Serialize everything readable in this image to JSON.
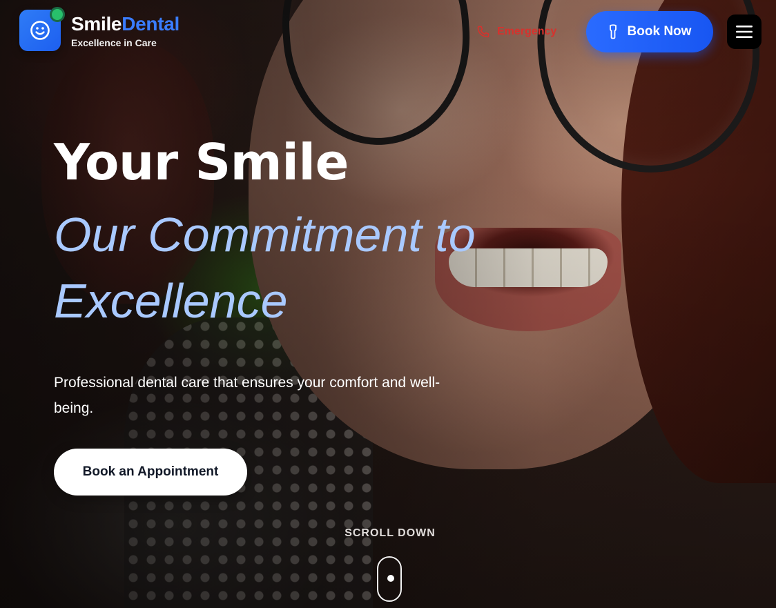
{
  "header": {
    "brand_part1": "Smile",
    "brand_part2": "Dental",
    "tagline": "Excellence in Care",
    "logo_icon": "smiley-face-icon",
    "emergency_label": "Emergency",
    "emergency_icon": "phone-icon",
    "book_now_label": "Book Now",
    "book_now_icon": "tooth-icon",
    "menu_icon": "hamburger-menu-icon"
  },
  "hero": {
    "title_line1": "Your Smile",
    "title_line2": "Our Commitment to Excellence",
    "subtitle": "Professional dental care that ensures your comfort and well-being.",
    "cta_label": "Book an Appointment",
    "scroll_label": "SCROLL DOWN",
    "scroll_icon": "mouse-scroll-icon"
  },
  "colors": {
    "brand_blue": "#1856f2",
    "accent_light_blue": "#a9c9ff",
    "emergency_red": "#d6322d",
    "status_green": "#28c06b"
  }
}
